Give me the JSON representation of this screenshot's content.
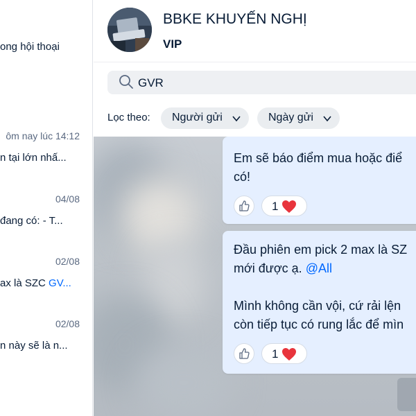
{
  "search_results": [
    {
      "time": "",
      "snippet": "ong hội thoại",
      "snippet_highlight": ""
    },
    {
      "time": "ôm nay lúc 14:12",
      "snippet": "n tại lớn nhấ...",
      "snippet_highlight": ""
    },
    {
      "time": "04/08",
      "snippet": "đang có: - T...",
      "snippet_highlight": ""
    },
    {
      "time": "02/08",
      "snippet": "ax là SZC ",
      "snippet_highlight": "GV..."
    },
    {
      "time": "02/08",
      "snippet": "n này sẽ là n...",
      "snippet_highlight": ""
    }
  ],
  "header": {
    "group_name": "BBKE KHUYẾN NGHỊ",
    "subtitle": "VIP"
  },
  "search": {
    "value": "GVR"
  },
  "filters": {
    "label": "Lọc theo:",
    "sender": "Người gửi",
    "date": "Ngày gửi"
  },
  "messages": [
    {
      "lines": [
        "Em sẽ báo điểm mua hoặc điể",
        "có!"
      ],
      "reaction_count": "1"
    },
    {
      "line1": "Đầu phiên em pick 2 max là SZ",
      "line2": "mới được ạ. ",
      "mention": "@All",
      "line3": "Mình không cần vội, cứ rải lện",
      "line4": "còn tiếp tục có rung lắc để mìn",
      "reaction_count": "1"
    }
  ],
  "colors": {
    "accent": "#0068ff",
    "bubble": "#e5efff",
    "heart": "#e8343c"
  },
  "icons": [
    "search-icon",
    "chevron-down-icon",
    "thumbs-up-icon",
    "heart-icon"
  ]
}
